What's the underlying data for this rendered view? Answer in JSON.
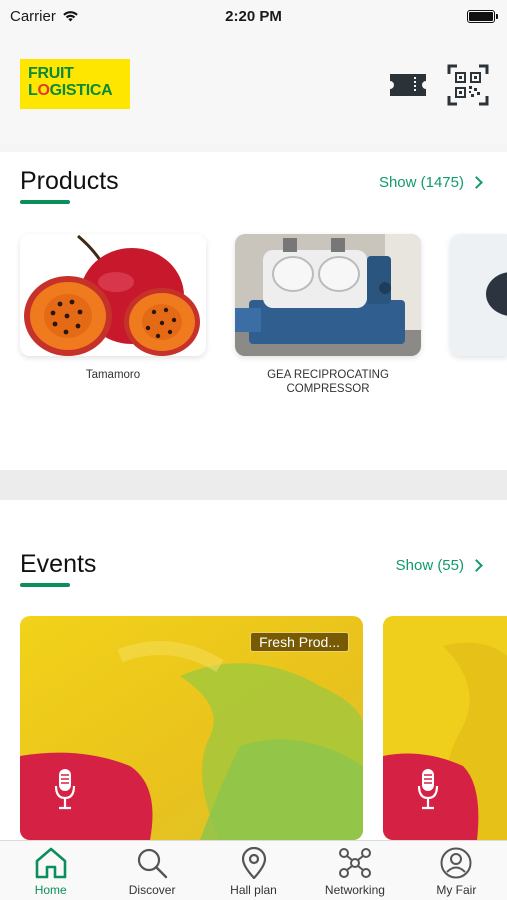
{
  "status_bar": {
    "carrier": "Carrier",
    "time": "2:20 PM"
  },
  "header": {
    "logo_line1": "FRUIT",
    "logo_line2_a": "L",
    "logo_line2_b": "O",
    "logo_line2_c": "GISTICA",
    "icons": [
      "ticket-icon",
      "qr-code-icon"
    ]
  },
  "products": {
    "title": "Products",
    "show_label": "Show (1475)",
    "items": [
      {
        "name": "Tamamoro"
      },
      {
        "name": "GEA RECIPROCATING COMPRESSOR"
      }
    ]
  },
  "events": {
    "title": "Events",
    "show_label": "Show (55)",
    "items": [
      {
        "tag": "Fresh Prod..."
      }
    ]
  },
  "tab_bar": {
    "active": "Home",
    "tabs": [
      {
        "label": "Home",
        "icon": "home-icon"
      },
      {
        "label": "Discover",
        "icon": "search-icon"
      },
      {
        "label": "Hall plan",
        "icon": "location-pin-icon"
      },
      {
        "label": "Networking",
        "icon": "network-icon"
      },
      {
        "label": "My Fair",
        "icon": "user-icon"
      }
    ]
  },
  "colors": {
    "accent": "#0a8f5a",
    "logo_bg": "#ffe600",
    "logo_text": "#0a8a3a"
  }
}
